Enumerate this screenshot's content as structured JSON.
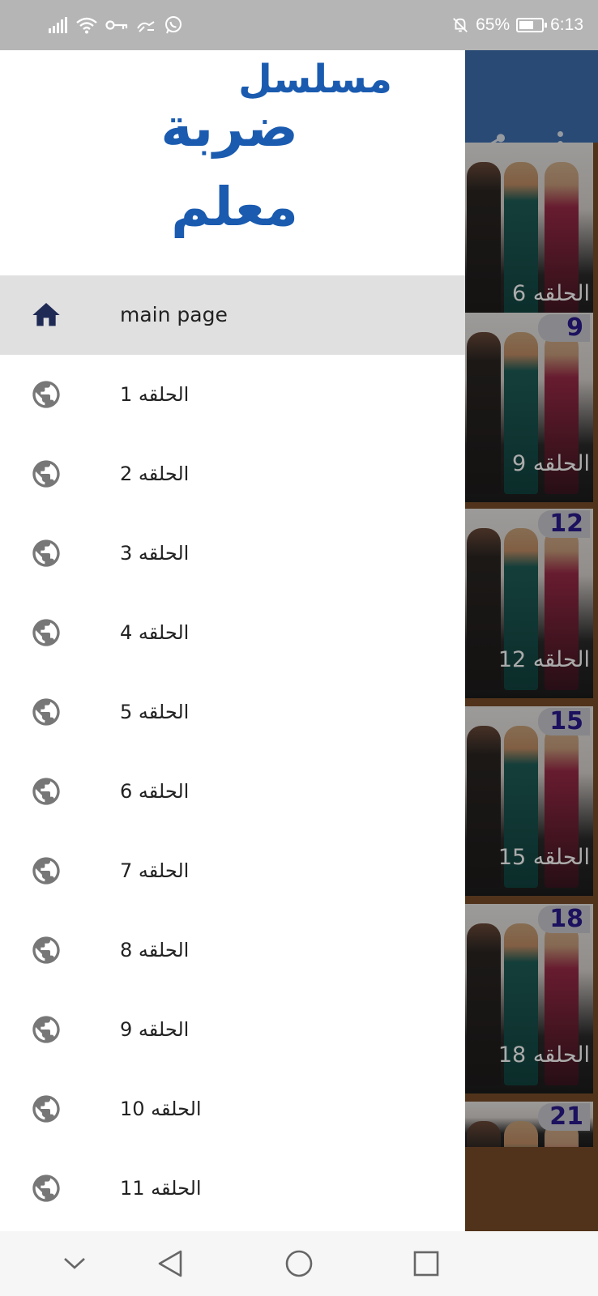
{
  "status_bar": {
    "battery": "65%",
    "battery_level": 0.65,
    "time": "6:13",
    "left_icons": [
      "signal-icon",
      "wifi-icon",
      "key-icon",
      "data-saver-icon",
      "whatsapp-icon"
    ],
    "right_icons": [
      "bell-off-icon",
      "battery-icon"
    ]
  },
  "drawer": {
    "header": {
      "line1": "مسلسل",
      "line2": "ضربة",
      "line3": "معلم"
    },
    "items": [
      {
        "label": "main page",
        "icon": "home-icon",
        "active": true
      },
      {
        "label": "الحلقه 1",
        "icon": "globe-icon"
      },
      {
        "label": "الحلقه 2",
        "icon": "globe-icon"
      },
      {
        "label": "الحلقه 3",
        "icon": "globe-icon"
      },
      {
        "label": "الحلقه 4",
        "icon": "globe-icon"
      },
      {
        "label": "الحلقه 5",
        "icon": "globe-icon"
      },
      {
        "label": "الحلقه 6",
        "icon": "globe-icon"
      },
      {
        "label": "الحلقه 7",
        "icon": "globe-icon"
      },
      {
        "label": "الحلقه 8",
        "icon": "globe-icon"
      },
      {
        "label": "الحلقه 9",
        "icon": "globe-icon"
      },
      {
        "label": "الحلقه 10",
        "icon": "globe-icon"
      },
      {
        "label": "الحلقه 11",
        "icon": "globe-icon"
      }
    ]
  },
  "background": {
    "toolbar_icons": [
      "share-icon",
      "more-vert-icon"
    ],
    "cards": [
      {
        "badge": "",
        "title": "الحلقه 6"
      },
      {
        "badge": "9",
        "title": "الحلقه 9"
      },
      {
        "badge": "12",
        "title": "الحلقه 12"
      },
      {
        "badge": "15",
        "title": "الحلقه 15"
      },
      {
        "badge": "18",
        "title": "الحلقه 18"
      },
      {
        "badge": "21",
        "title": ""
      }
    ]
  },
  "nav_bar": {
    "buttons": [
      "chevron-down-icon",
      "back-icon",
      "home-circle-icon",
      "recents-icon"
    ]
  },
  "colors": {
    "status_bar": "#b5b5b5",
    "logo_blue": "#1a5bb0",
    "active_item": "#e0e0e0",
    "menu_icon_home": "#1f2a55",
    "menu_icon_globe": "#777777",
    "toolbar": "#3f6fb0",
    "badge_text": "#2a1a8c"
  }
}
